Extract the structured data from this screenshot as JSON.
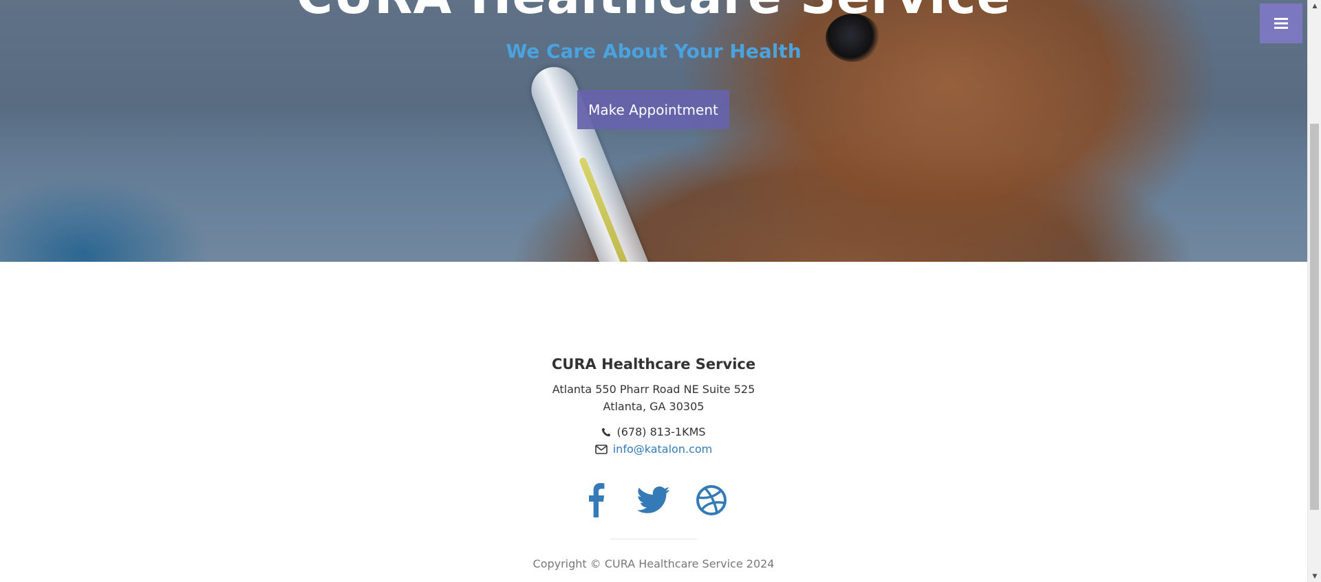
{
  "hero": {
    "title": "CURA Healthcare Service",
    "subtitle": "We Care About Your Health",
    "button_label": "Make Appointment"
  },
  "menu": {
    "icon": "bars-icon"
  },
  "footer": {
    "title": "CURA Healthcare Service",
    "address_line1": "Atlanta 550 Pharr Road NE Suite 525",
    "address_line2": "Atlanta, GA 30305",
    "phone": "(678) 813-1KMS",
    "email": "info@katalon.com",
    "social": [
      "facebook-icon",
      "twitter-icon",
      "dribbble-icon"
    ],
    "copyright": "Copyright © CURA Healthcare Service 2024"
  },
  "colors": {
    "accent_button": "#6763ac",
    "subtitle": "#4aa3df",
    "link": "#337ab7",
    "social": "#337ab7",
    "menu_toggle": "#7b78c0"
  }
}
